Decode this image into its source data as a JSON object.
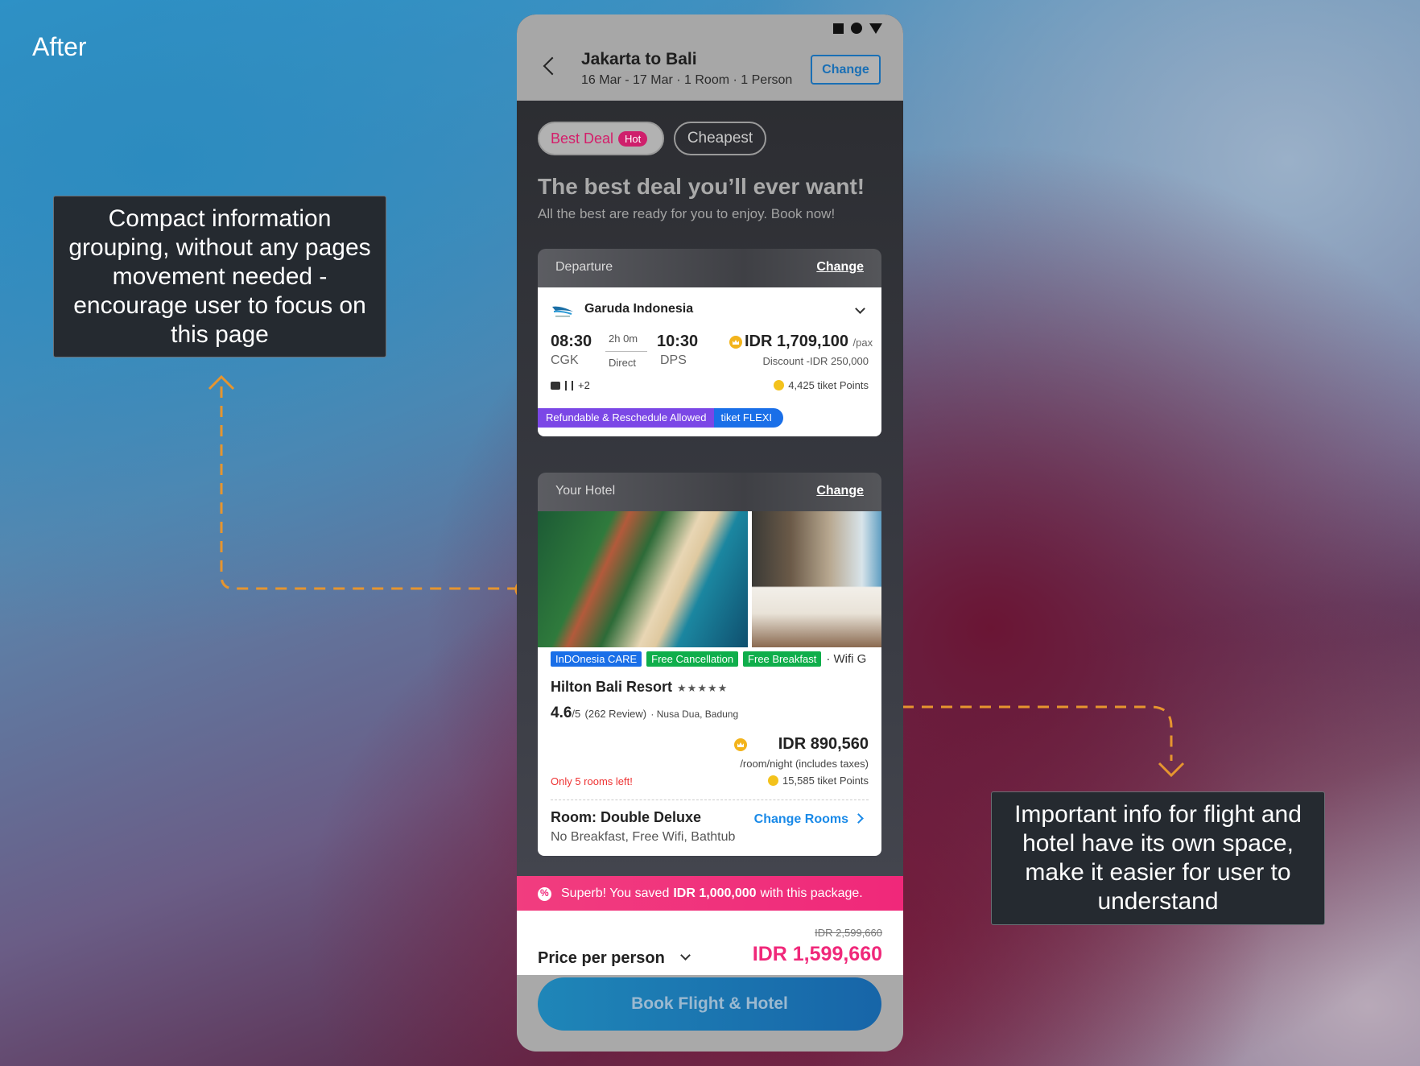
{
  "page": {
    "label": "After",
    "callout_left": "Compact information grouping, without any pages movement needed - encourage user to focus on this page",
    "callout_right": "Important info for flight and hotel have its own space, make it easier for user to understand"
  },
  "header": {
    "title": "Jakarta to Bali",
    "subtitle": "16 Mar - 17 Mar · 1 Room · 1 Person",
    "change_label": "Change"
  },
  "tabs": {
    "best_deal": "Best Deal",
    "hot_badge": "Hot",
    "cheapest": "Cheapest"
  },
  "hero": {
    "title": "The best deal you’ll ever want!",
    "subtitle": "All the best are ready for you to enjoy. Book now!"
  },
  "departure": {
    "heading": "Departure",
    "change_label": "Change",
    "airline": "Garuda Indonesia",
    "dep_time": "08:30",
    "dep_code": "CGK",
    "duration": "2h 0m",
    "stops": "Direct",
    "arr_time": "10:30",
    "arr_code": "DPS",
    "price": "IDR 1,709,100",
    "price_unit": "/pax",
    "discount": "Discount -IDR 250,000",
    "amenities_extra": "+2",
    "points": "4,425 tiket Points",
    "flexi_a": "Refundable & Reschedule Allowed",
    "flexi_b": "tiket FLEXI"
  },
  "hotel": {
    "heading": "Your Hotel",
    "change_label": "Change",
    "tags": [
      "InDOnesia CARE",
      "Free Cancellation",
      "Free Breakfast"
    ],
    "tag_more": "· Wifi G",
    "name": "Hilton Bali Resort",
    "stars": "★★★★★",
    "rating": "4.6",
    "rating_scale": "/5",
    "reviews": "(262 Review)",
    "location": "· Nusa Dua, Badung",
    "price": "IDR 890,560",
    "price_unit": "/room/night (includes taxes)",
    "scarcity": "Only 5 rooms left!",
    "points": "15,585 tiket Points",
    "room_name": "Room: Double Deluxe",
    "room_desc": "No Breakfast, Free Wifi, Bathtub",
    "change_rooms": "Change Rooms"
  },
  "summary": {
    "saved_prefix": "Superb! You saved",
    "saved_amount": "IDR 1,000,000",
    "saved_suffix": "with this package.",
    "original_price": "IDR 2,599,660",
    "price_label": "Price per person",
    "total_price": "IDR 1,599,660",
    "book_button": "Book Flight & Hotel"
  },
  "colors": {
    "accent_pink": "#f0287a",
    "accent_blue": "#1a6fb5",
    "connector_orange": "#e6952f"
  }
}
